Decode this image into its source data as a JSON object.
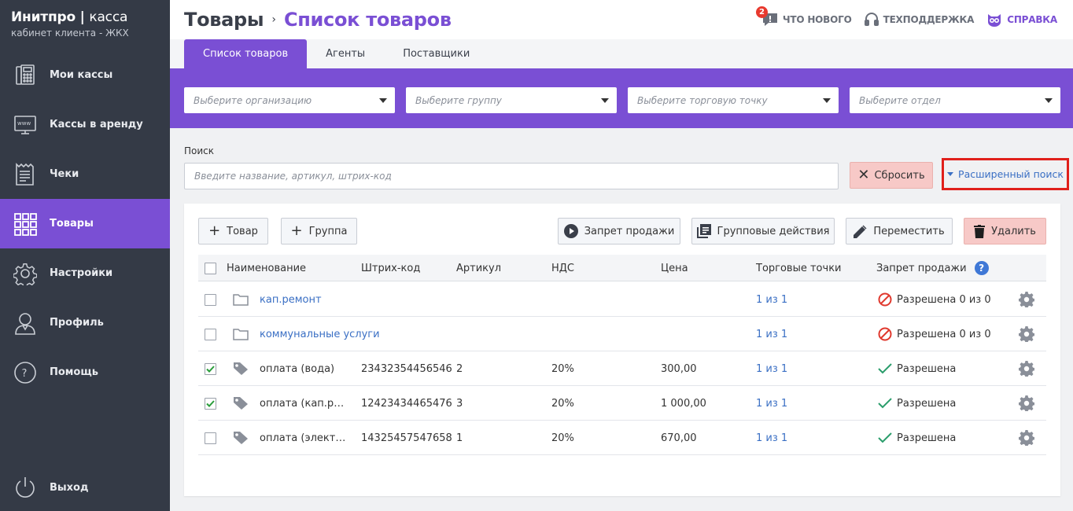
{
  "brand": {
    "name_bold": "Инитпро",
    "name_sep": " | ",
    "name_light": "касса",
    "subtitle": "кабинет клиента - ЖКХ"
  },
  "sidebar": {
    "items": [
      {
        "label": "Мои кассы",
        "icon": "cash-register-icon"
      },
      {
        "label": "Кассы в аренду",
        "icon": "www-monitor-icon"
      },
      {
        "label": "Чеки",
        "icon": "receipt-icon"
      },
      {
        "label": "Товары",
        "icon": "grid-icon"
      },
      {
        "label": "Настройки",
        "icon": "gear-icon"
      },
      {
        "label": "Профиль",
        "icon": "user-icon"
      },
      {
        "label": "Помощь",
        "icon": "question-circle-icon"
      }
    ],
    "logout": {
      "label": "Выход",
      "icon": "power-icon"
    }
  },
  "header": {
    "crumb_root": "Товары",
    "crumb_sep": "›",
    "crumb_current": "Список товаров",
    "whats_new": {
      "label": "ЧТО НОВОГО",
      "badge": "2"
    },
    "support": {
      "label": "ТЕХПОДДЕРЖКА"
    },
    "help": {
      "label": "СПРАВКА"
    }
  },
  "tabs": [
    "Список товаров",
    "Агенты",
    "Поставщики"
  ],
  "filters": {
    "organization": "Выберите организацию",
    "group": "Выберите группу",
    "point": "Выберите торговую точку",
    "department": "Выберите отдел"
  },
  "search": {
    "label": "Поиск",
    "placeholder": "Введите название, артикул, штрих-код",
    "value": "",
    "reset_label": "Сбросить",
    "advanced_label": "Расширенный поиск"
  },
  "toolbar": {
    "add_product": "Товар",
    "add_group": "Группа",
    "sale_ban": "Запрет продажи",
    "group_actions": "Групповые действия",
    "move": "Переместить",
    "delete": "Удалить"
  },
  "table": {
    "columns": [
      "Наименование",
      "Штрих-код",
      "Артикул",
      "НДС",
      "Цена",
      "Торговые точки",
      "Запрет продажи"
    ],
    "rows": [
      {
        "type": "folder",
        "checked": false,
        "name": "кап.ремонт",
        "barcode": "",
        "article": "",
        "vat": "",
        "price": "",
        "points": "1 из 1",
        "status": "Разрешена 0 из 0",
        "status_kind": "partial"
      },
      {
        "type": "folder",
        "checked": false,
        "name": "коммунальные услуги",
        "barcode": "",
        "article": "",
        "vat": "",
        "price": "",
        "points": "1 из 1",
        "status": "Разрешена 0 из 0",
        "status_kind": "partial"
      },
      {
        "type": "product",
        "checked": true,
        "name": "оплата (вода)",
        "barcode": "23432354456546",
        "article": "2",
        "vat": "20%",
        "price": "300,00",
        "points": "1 из 1",
        "status": "Разрешена",
        "status_kind": "allowed"
      },
      {
        "type": "product",
        "checked": true,
        "name": "оплата (кап.рем...",
        "barcode": "12423434465476",
        "article": "3",
        "vat": "20%",
        "price": "1 000,00",
        "points": "1 из 1",
        "status": "Разрешена",
        "status_kind": "allowed"
      },
      {
        "type": "product",
        "checked": false,
        "name": "оплата (электро...",
        "barcode": "14325457547658",
        "article": "1",
        "vat": "20%",
        "price": "670,00",
        "points": "1 из 1",
        "status": "Разрешена",
        "status_kind": "allowed"
      }
    ]
  },
  "colors": {
    "accent": "#7a4fd4",
    "sidebar_bg": "#343a46",
    "link": "#3a6fc4",
    "danger": "#f7c9c7",
    "highlight_border": "#e0201b",
    "ok_green": "#2a9d6b",
    "ban_red": "#e0392e"
  }
}
